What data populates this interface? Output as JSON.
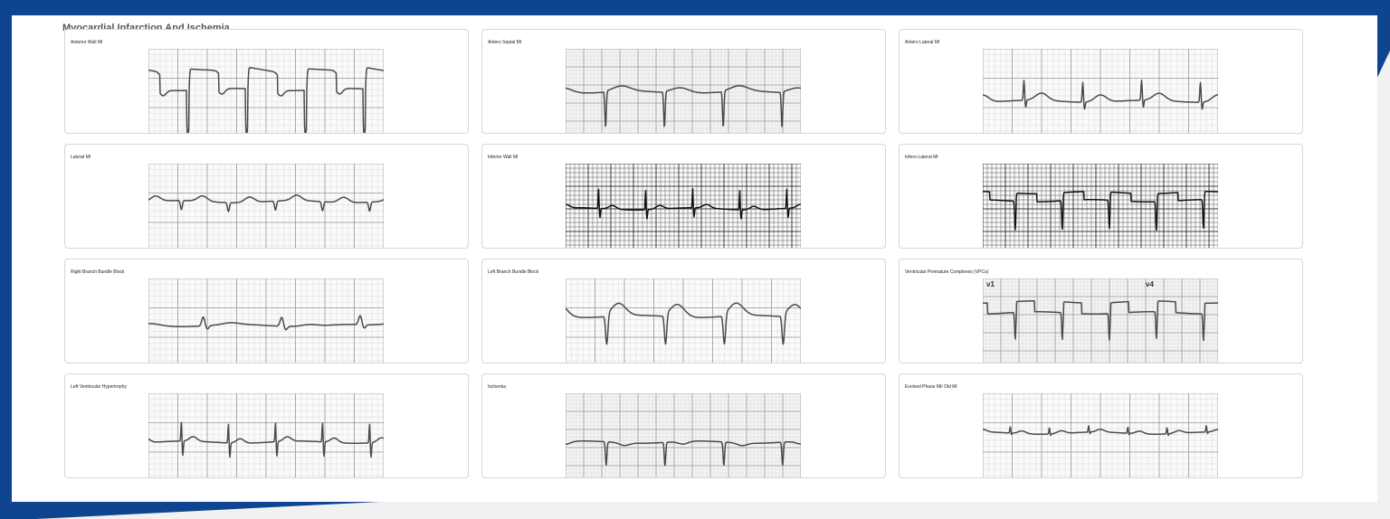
{
  "page": {
    "title": "Myocardial Infarction And Ischemia",
    "colors": {
      "frame": "#0f4590",
      "panel": "#ffffff",
      "card_border": "#d6d6d6",
      "title_text": "#555555"
    }
  },
  "cards": [
    {
      "label": "Anterior Wall MI",
      "paper": "light",
      "lead_marks": []
    },
    {
      "label": "Antero Septal MI",
      "paper": "fine",
      "lead_marks": []
    },
    {
      "label": "Antero Lateral MI",
      "paper": "light",
      "lead_marks": []
    },
    {
      "label": "Lateral MI",
      "paper": "light",
      "lead_marks": []
    },
    {
      "label": "Inferior Wall MI",
      "paper": "dark",
      "lead_marks": []
    },
    {
      "label": "Infero-Lateral MI",
      "paper": "dark",
      "lead_marks": []
    },
    {
      "label": "Right Branch Bundle Block",
      "paper": "light",
      "lead_marks": []
    },
    {
      "label": "Left Branch Bundle Block",
      "paper": "light",
      "lead_marks": []
    },
    {
      "label": "Ventricular Premature Complexes (VPCs)",
      "paper": "fine",
      "lead_marks": [
        "v1",
        "v4"
      ]
    },
    {
      "label": "Left Ventricular Hypertrophy",
      "paper": "light",
      "lead_marks": []
    },
    {
      "label": "Ischemia",
      "paper": "fine",
      "lead_marks": []
    },
    {
      "label": "Evolved Phase MI/ Old MI",
      "paper": "light",
      "lead_marks": []
    }
  ]
}
